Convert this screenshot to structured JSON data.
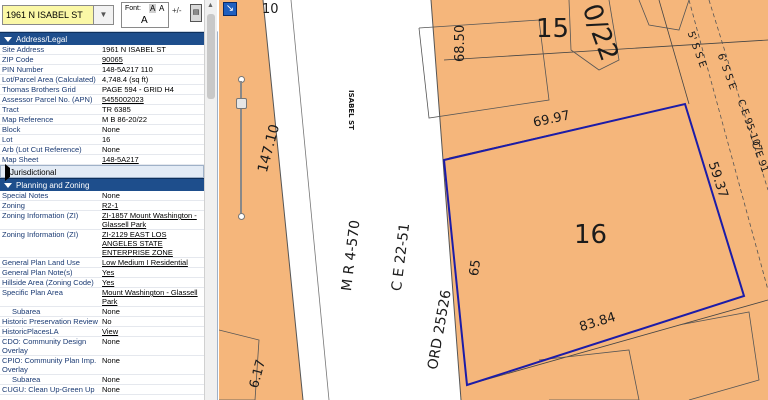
{
  "search": {
    "address": "1961 N ISABEL ST"
  },
  "font": {
    "label": "Font:",
    "a_small": "A",
    "a_mid": "A",
    "a_large": "A",
    "zoom_buttons": "+/-"
  },
  "sections": {
    "address_legal": {
      "title": "Address/Legal",
      "rows": [
        {
          "k": "Site Address",
          "v": "1961 N ISABEL ST"
        },
        {
          "k": "ZIP Code",
          "v": "90065"
        },
        {
          "k": "PIN Number",
          "v": "148-5A217 110"
        },
        {
          "k": "Lot/Parcel Area (Calculated)",
          "v": "4,748.4 (sq ft)"
        },
        {
          "k": "Thomas Brothers Grid",
          "v": "PAGE 594 - GRID H4"
        },
        {
          "k": "Assessor Parcel No. (APN)",
          "v": "5455002023"
        },
        {
          "k": "Tract",
          "v": "TR 6385"
        },
        {
          "k": "Map Reference",
          "v": "M B 86-20/22"
        },
        {
          "k": "Block",
          "v": "None"
        },
        {
          "k": "Lot",
          "v": "16"
        },
        {
          "k": "Arb (Lot Cut Reference)",
          "v": "None"
        },
        {
          "k": "Map Sheet",
          "v": "148-5A217"
        }
      ]
    },
    "jurisdictional": {
      "title": "Jurisdictional"
    },
    "planning": {
      "title": "Planning and Zoning",
      "rows": [
        {
          "k": "Special Notes",
          "v": "None"
        },
        {
          "k": "Zoning",
          "v": "R2-1"
        },
        {
          "k": "Zoning Information (ZI)",
          "v": "ZI-1857 Mount Washington - Glassell Park"
        },
        {
          "k": "Zoning Information (ZI)",
          "v": "ZI-2129 EAST LOS ANGELES STATE ENTERPRISE ZONE"
        },
        {
          "k": "General Plan Land Use",
          "v": "Low Medium I Residential"
        },
        {
          "k": "General Plan Note(s)",
          "v": "Yes"
        },
        {
          "k": "Hillside Area (Zoning Code)",
          "v": "Yes"
        },
        {
          "k": "Specific Plan Area",
          "v": "Mount Washington - Glassell Park"
        },
        {
          "k": "Subarea",
          "v": "None"
        },
        {
          "k": "Historic Preservation Review",
          "v": "No"
        },
        {
          "k": "HistoricPlacesLA",
          "v": "View"
        },
        {
          "k": "CDO: Community Design Overlay",
          "v": "None"
        },
        {
          "k": "CPIO: Community Plan Imp. Overlay",
          "v": "None"
        },
        {
          "k": "Subarea",
          "v": "None"
        },
        {
          "k": "CUGU: Clean Up-Green Up",
          "v": "None"
        }
      ]
    }
  },
  "map": {
    "street_name": "ISABEL ST",
    "lot_number": "16",
    "neighbor_lot": "15",
    "dim_top": "69.97",
    "dim_right": "59.37",
    "dim_bottom": "83.84",
    "dim_left": "65",
    "dim_neighbor": "68.50",
    "dim_street_left": "147.10",
    "map_ref_1": "M R 4-570",
    "map_ref_2": "C E 22-51",
    "ordinance": "ORD 25526",
    "top_10": "10",
    "top_22": "0/22",
    "right_labels": [
      "5' S S E",
      "6' S S E",
      "C E 95-107",
      "C E 91"
    ],
    "bottom_left": "6.17"
  }
}
